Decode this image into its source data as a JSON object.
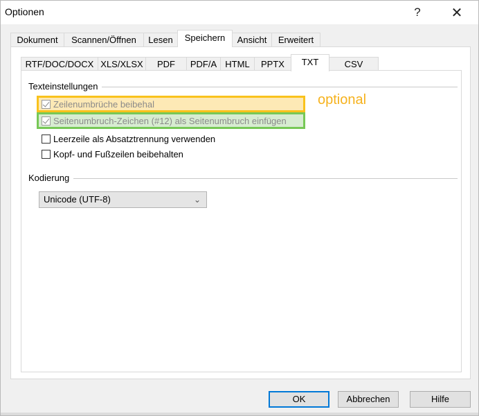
{
  "window": {
    "title": "Optionen",
    "help_label": "?",
    "close_label": "✕"
  },
  "outer_tabs": [
    {
      "label": "Dokument",
      "active": false
    },
    {
      "label": "Scannen/Öffnen",
      "active": false
    },
    {
      "label": "Lesen",
      "active": false
    },
    {
      "label": "Speichern",
      "active": true
    },
    {
      "label": "Ansicht",
      "active": false
    },
    {
      "label": "Erweitert",
      "active": false
    }
  ],
  "inner_tabs": [
    {
      "label": "RTF/DOC/DOCX",
      "active": false
    },
    {
      "label": "XLS/XLSX",
      "active": false
    },
    {
      "label": "PDF",
      "active": false
    },
    {
      "label": "PDF/A",
      "active": false
    },
    {
      "label": "HTML",
      "active": false
    },
    {
      "label": "PPTX",
      "active": false
    },
    {
      "label": "TXT",
      "active": true
    },
    {
      "label": "CSV",
      "active": false
    }
  ],
  "text_settings": {
    "group_label": "Texteinstellungen",
    "options": [
      {
        "label": "Zeilenumbrüche beibehal",
        "checked": true,
        "disabled": true,
        "highlight": "#f9c21c"
      },
      {
        "label": "Seitenumbruch-Zeichen (#12) als Seitenumbruch einfügen",
        "checked": true,
        "disabled": true,
        "highlight": "#77c856"
      },
      {
        "label": "Leerzeile als Absatztrennung verwenden",
        "checked": false,
        "disabled": false
      },
      {
        "label": "Kopf- und Fußzeilen beibehalten",
        "checked": false,
        "disabled": false
      }
    ],
    "annotation": "optional"
  },
  "encoding": {
    "group_label": "Kodierung",
    "selected": "Unicode (UTF-8)"
  },
  "buttons": {
    "ok": "OK",
    "cancel": "Abbrechen",
    "help": "Hilfe"
  },
  "colors": {
    "accent": "#0078d7",
    "highlight_yellow": "#f9c21c",
    "highlight_green": "#77c856",
    "annotation_text": "#f6b21d"
  }
}
